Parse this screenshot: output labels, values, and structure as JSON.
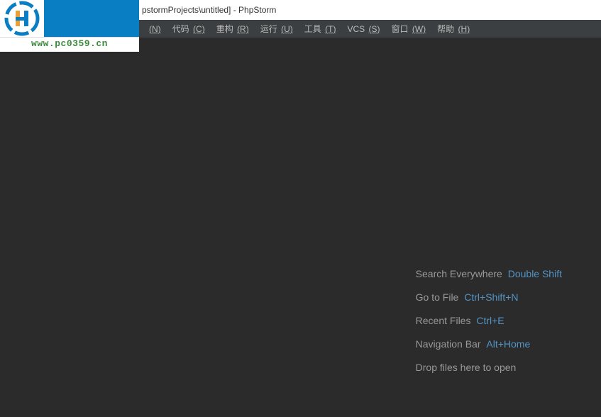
{
  "titleBar": {
    "text": "pstormProjects\\untitled] - PhpStorm"
  },
  "menuBar": {
    "items": [
      {
        "label": "",
        "mnemonic": "(N)"
      },
      {
        "label": "代码",
        "mnemonic": "(C)"
      },
      {
        "label": "重构",
        "mnemonic": "(R)"
      },
      {
        "label": "运行",
        "mnemonic": "(U)"
      },
      {
        "label": "工具",
        "mnemonic": "(T)"
      },
      {
        "label": "VCS",
        "mnemonic": "(S)"
      },
      {
        "label": "窗口",
        "mnemonic": "(W)"
      },
      {
        "label": "帮助",
        "mnemonic": "(H)"
      }
    ]
  },
  "logo": {
    "url": "www.pc0359.cn"
  },
  "hints": {
    "searchEverywhere": {
      "label": "Search Everywhere",
      "shortcut": "Double Shift"
    },
    "goToFile": {
      "label": "Go to File",
      "shortcut": "Ctrl+Shift+N"
    },
    "recentFiles": {
      "label": "Recent Files",
      "shortcut": "Ctrl+E"
    },
    "navigationBar": {
      "label": "Navigation Bar",
      "shortcut": "Alt+Home"
    },
    "dropFiles": {
      "label": "Drop files here to open"
    }
  }
}
